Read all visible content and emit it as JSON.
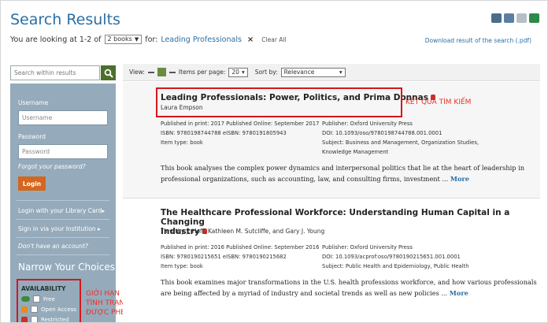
{
  "header": {
    "title": "Search Results",
    "looking_prefix": "You are looking at 1-2 of",
    "count_select": "2 books",
    "for_label": "for:",
    "search_term": "Leading Professionals",
    "remove_symbol": "×",
    "clear_all": "Clear All",
    "download": "Download result of the search (.pdf)",
    "tools": [
      "print-icon",
      "save-icon",
      "email-icon",
      "add-icon"
    ]
  },
  "search_within": {
    "placeholder": "Search within results",
    "button_icon": "search-icon"
  },
  "view_bar": {
    "view_label": "View:",
    "items_per_page_label": "Items per page:",
    "items_per_page": "20",
    "sort_label": "Sort by:",
    "sort_value": "Relevance"
  },
  "sidebar": {
    "username_label": "Username",
    "username_placeholder": "Username",
    "password_label": "Password",
    "password_placeholder": "Password",
    "forgot": "Forgot your password?",
    "login": "Login",
    "library_card": "Login with your Library Card▸",
    "institution": "Sign in via your Institution ▸",
    "no_account": "Don't have an account?",
    "narrow": "Narrow Your Choices",
    "availability_title": "AVAILABILITY",
    "availability_items": [
      {
        "badge": "free-badge",
        "label": "Free"
      },
      {
        "badge": "open-access-icon",
        "label": "Open Access"
      },
      {
        "badge": "lock-icon",
        "label": "Restricted"
      }
    ],
    "annotation": [
      "GIỚI HẠN",
      "TÌNH TRẠNG TÀI LIỆU",
      "ĐƯỢC PHÉP TRUY CẬP"
    ]
  },
  "results": [
    {
      "title": "Leading Professionals: Power, Politics, and Prima Donnas",
      "authors": "Laura Empson",
      "published": "Published in print: 2017 Published Online: September 2017",
      "isbn": "ISBN: 9780198744788 eISBN: 9780191805943",
      "item_type": "Item type: book",
      "publisher": "Publisher: Oxford University Press",
      "doi": "DOI: 10.1093/oso/9780198744788.001.0001",
      "subject_1": "Subject: Business and Management, Organization Studies,",
      "subject_2": "Knowledge Management",
      "description_1": "This book analyses the complex power dynamics and interpersonal politics that lie at the heart of leadership in",
      "description_2": "professional organizations, such as accounting, law, and consulting firms, investment ...",
      "more": "More",
      "annotation": "KẾT QUẢ TÌM KIẾM"
    },
    {
      "title_1": "The Healthcare Professional Workforce: Understanding Human Capital in a Changing",
      "title_2": "Industry",
      "authors": "Timothy J. Hoff, Kathleen M. Sutcliffe, and Gary J. Young",
      "published": "Published in print: 2016 Published Online: September 2016",
      "isbn": "ISBN: 9780190215651 eISBN: 9780190215682",
      "item_type": "Item type: book",
      "publisher": "Publisher: Oxford University Press",
      "doi": "DOI: 10.1093/acprof:oso/9780190215651.001.0001",
      "subject_1": "Subject: Public Health and Epidemiology, Public Health",
      "description_1": "This book examines major transformations in the U.S. health professions workforce, and how various professionals",
      "description_2": "are being affected by a myriad of industry and societal trends as well as new policies ...",
      "more": "More"
    }
  ],
  "colors": {
    "title_blue": "#2a6fa4",
    "sidebar": "#95abbb",
    "login_orange": "#d5661d",
    "annotation_red": "#e5332a"
  }
}
